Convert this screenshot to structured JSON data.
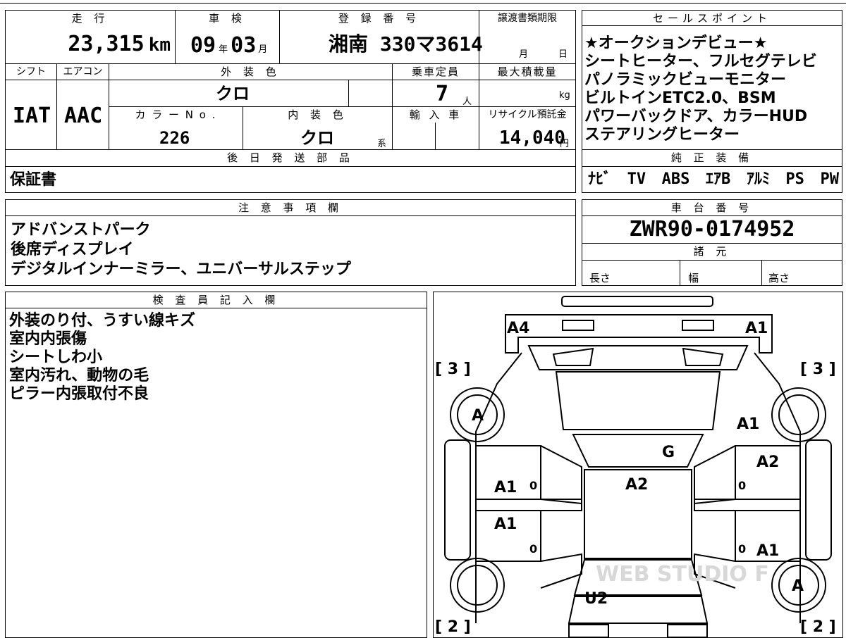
{
  "top_table": {
    "headers": {
      "mileage": "走 行",
      "inspection": "車 検",
      "registration": "登 録 番 号",
      "transfer_deadline": "譲渡書類期限",
      "shift": "シフト",
      "aircon": "エアコン",
      "exterior_color": "外 装 色",
      "capacity": "乗車定員",
      "max_load": "最大積載量",
      "color_no": "カ ラ ー N o .",
      "interior_color": "内 装 色",
      "import": "輸 入 車",
      "recycle": "リサイクル預託金",
      "later_parts": "後 日 発 送 部 品"
    },
    "mileage_value": "23,315",
    "mileage_unit": "km",
    "inspection_year": "09",
    "year_unit": "年",
    "inspection_month": "03",
    "month_unit": "月",
    "registration_value": "湘南 330マ3614",
    "deadline_month_unit": "月",
    "deadline_day_unit": "日",
    "shift_value": "IAT",
    "aircon_value": "AAC",
    "exterior_color_value": "クロ",
    "capacity_value": "7",
    "capacity_unit": "人",
    "load_unit": "kg",
    "color_no_value": "226",
    "interior_color_value": "クロ",
    "interior_suffix": "系",
    "recycle_value": "14,040",
    "recycle_unit": "円",
    "later_parts_value": "保証書"
  },
  "sales_points": {
    "header": "セールスポイント",
    "lines": [
      "★オークションデビュー★",
      "シートヒーター、フルセグテレビ",
      "パノラミックビューモニター",
      "ビルトインETC2.0、BSM",
      "パワーバックドア、カラーHUD",
      "ステアリングヒーター"
    ]
  },
  "equipment": {
    "header": "純 正 装 備",
    "items": [
      "ﾅﾋﾞ",
      "TV",
      "ABS",
      "ｴｱB",
      "ｱﾙﾐ",
      "PS",
      "PW"
    ]
  },
  "notes": {
    "header": "注 意 事 項 欄",
    "lines": [
      "アドバンストパーク",
      "後席ディスプレイ",
      "デジタルインナーミラー、ユニバーサルステップ"
    ]
  },
  "chassis": {
    "header": "車 台 番 号",
    "value": "ZWR90-0174952",
    "specs_header": "諸 元",
    "length_label": "長さ",
    "width_label": "幅",
    "height_label": "高さ"
  },
  "inspector": {
    "header": "検 査 員 記 入 欄",
    "lines": [
      "外装のり付、うすい線キズ",
      "室内内張傷",
      "シートしわ小",
      "室内汚れ、動物の毛",
      "ピラー内張取付不良"
    ]
  },
  "diagram": {
    "marks": {
      "front_left_bumper": "A4",
      "front_right_bumper": "A1",
      "left_tire_front_grade": "[ 3 ]",
      "right_tire_front_grade": "[ 3 ]",
      "front_left_wheel": "A",
      "right_fender": "A1",
      "windshield": "G",
      "right_front_door": "A2",
      "left_front_door": "A1",
      "roof": "A2",
      "left_rear_door": "A1",
      "right_rear_door": "A1",
      "rear_right_wheel": "A",
      "rear": "U2",
      "left_tire_rear_grade": "[ 2 ]",
      "right_tire_rear_grade": "[ 2 ]",
      "door_zero_1": "0",
      "door_zero_2": "0",
      "door_zero_3": "0",
      "door_zero_4": "0"
    },
    "watermark": "WEB STUDIO F"
  },
  "colors": {
    "border": "#000000",
    "background": "#ffffff",
    "watermark": "#d8d8d8"
  }
}
